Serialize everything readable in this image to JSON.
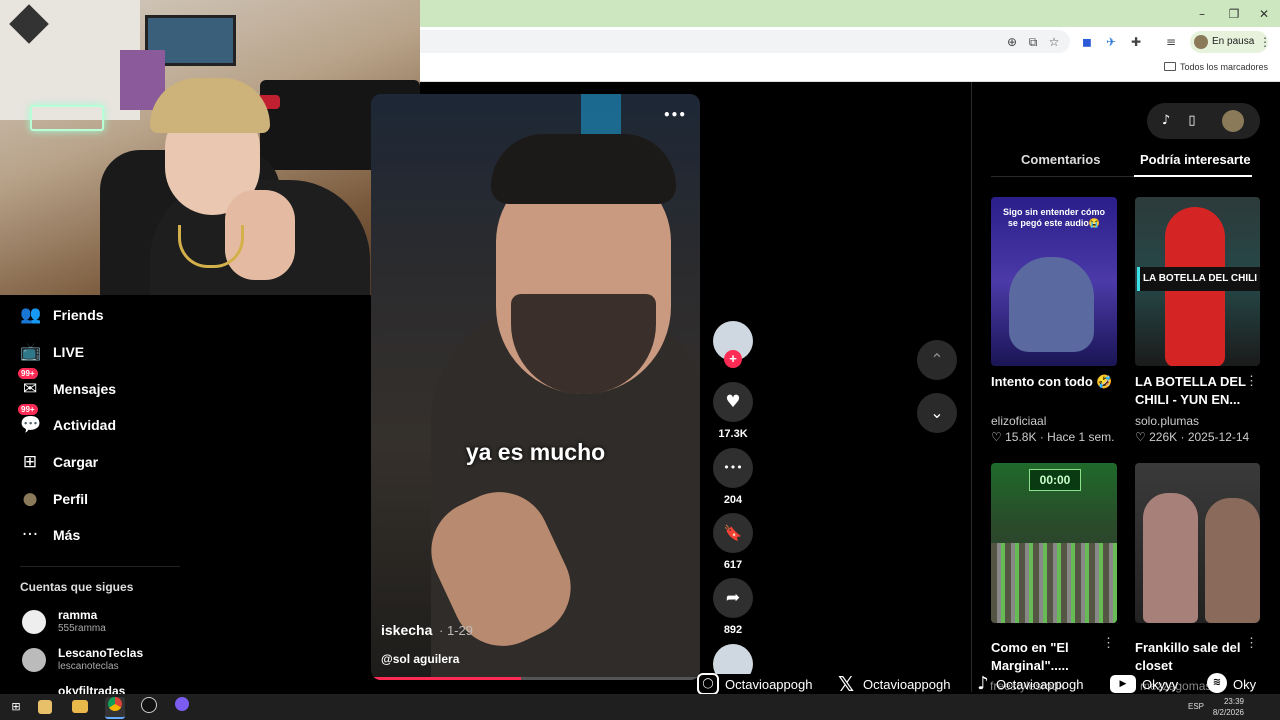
{
  "browser": {
    "window_controls": {
      "minimize": "–",
      "restore": "❐",
      "close": "✕"
    },
    "toolbar_icons": {
      "zoom": "⊕",
      "install": "⧉",
      "star": "☆",
      "ext1": "◼",
      "ext2": "✈",
      "puzzle": "✚",
      "media": "≡",
      "menu": "⋮"
    },
    "profile_status": "En pausa",
    "bookmarks_label": "Todos los marcadores",
    "bookmarks_icon": "folder-icon"
  },
  "sidebar": {
    "items": [
      {
        "label": "Friends",
        "icon": "👥"
      },
      {
        "label": "LIVE",
        "icon": "📺"
      },
      {
        "label": "Mensajes",
        "icon": "✉",
        "badge": "99+"
      },
      {
        "label": "Actividad",
        "icon": "💬",
        "badge": "99+"
      },
      {
        "label": "Cargar",
        "icon": "⊞"
      },
      {
        "label": "Perfil",
        "icon": "●"
      },
      {
        "label": "Más",
        "icon": "···"
      }
    ],
    "following_title": "Cuentas que sigues",
    "following": [
      {
        "name": "ramma",
        "handle": "555ramma"
      },
      {
        "name": "LescanoTeclas",
        "handle": "lescanoteclas"
      },
      {
        "name": "okyfiltradas",
        "handle": ""
      }
    ]
  },
  "video": {
    "subtitle": "ya es mucho",
    "author": "iskecha",
    "date": "· 1-29",
    "mention": "@sol aguilera",
    "progress": 0.455,
    "more_icon": "•••"
  },
  "actions": {
    "follow_plus": "+",
    "like_icon": "♥",
    "like_count": "17.3K",
    "comment_icon": "•••",
    "comment_count": "204",
    "save_icon": "🔖",
    "save_count": "617",
    "share_icon": "➦",
    "share_count": "892"
  },
  "nav": {
    "up": "⌃",
    "down": "⌄"
  },
  "right_panel": {
    "tabs": [
      "Comentarios",
      "Podría interesarte"
    ],
    "pill_icons": {
      "tiktok": "♪",
      "phone": "▯"
    },
    "cards": [
      {
        "title": "Intento con todo 🤣",
        "author": "elizoficiaal",
        "likes": "15.8K",
        "date": "Hace 1 sem.",
        "thumb_text": "Sigo sin entender cómo se pegó este audio😭",
        "more": "⋮"
      },
      {
        "title": "LA BOTELLA DEL CHILI - YUN EN...",
        "author": "solo.plumas",
        "likes": "226K",
        "date": "2025-12-14",
        "thumb_text": "LA BOTELLA DEL CHILI",
        "more": "⋮"
      },
      {
        "title": "Como en \"El Marginal\".....",
        "author": "",
        "likes": "",
        "date": "",
        "thumb_text": "00:00",
        "more": "⋮"
      },
      {
        "title": "Frankillo sale del closet",
        "author": "",
        "likes": "",
        "date": "",
        "thumb_text": "",
        "more": "⋮"
      }
    ],
    "heart_glyph": "♡",
    "dot_sep": "·"
  },
  "overlay": {
    "instagram": "Octavioappogh",
    "x": "Octavioappogh",
    "tiktok": "Octavioappogh",
    "youtube": "Okyyy",
    "spotify": "Oky",
    "behind_texts": [
      "freestylesrodk",
      "mezzagomas"
    ]
  },
  "taskbar": {
    "lang": "ESP",
    "time": "23:39",
    "date": "8/2/2026",
    "start_icon": "⊞"
  }
}
